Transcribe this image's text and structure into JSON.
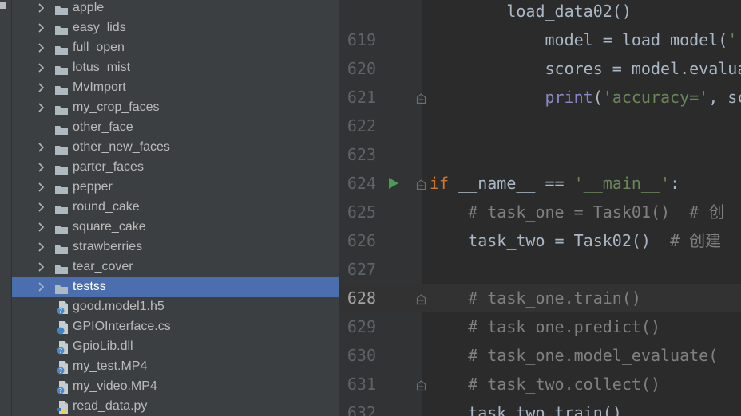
{
  "project_tree": {
    "items": [
      {
        "label": "apple",
        "kind": "folder",
        "expandable": true,
        "selected": false
      },
      {
        "label": "easy_lids",
        "kind": "folder",
        "expandable": true,
        "selected": false
      },
      {
        "label": "full_open",
        "kind": "folder",
        "expandable": true,
        "selected": false
      },
      {
        "label": "lotus_mist",
        "kind": "folder",
        "expandable": true,
        "selected": false
      },
      {
        "label": "MvImport",
        "kind": "folder",
        "expandable": true,
        "selected": false
      },
      {
        "label": "my_crop_faces",
        "kind": "folder",
        "expandable": true,
        "selected": false
      },
      {
        "label": "other_face",
        "kind": "folder",
        "expandable": false,
        "selected": false
      },
      {
        "label": "other_new_faces",
        "kind": "folder",
        "expandable": true,
        "selected": false
      },
      {
        "label": "parter_faces",
        "kind": "folder",
        "expandable": true,
        "selected": false
      },
      {
        "label": "pepper",
        "kind": "folder",
        "expandable": true,
        "selected": false
      },
      {
        "label": "round_cake",
        "kind": "folder",
        "expandable": true,
        "selected": false
      },
      {
        "label": "square_cake",
        "kind": "folder",
        "expandable": true,
        "selected": false
      },
      {
        "label": "strawberries",
        "kind": "folder",
        "expandable": true,
        "selected": false
      },
      {
        "label": "tear_cover",
        "kind": "folder",
        "expandable": true,
        "selected": false
      },
      {
        "label": "testss",
        "kind": "folder",
        "expandable": true,
        "selected": true
      },
      {
        "label": "good.model1.h5",
        "kind": "file",
        "icon": "unknown-file-icon",
        "selected": false
      },
      {
        "label": "GPIOInterface.cs",
        "kind": "file",
        "icon": "csharp-file-icon",
        "selected": false
      },
      {
        "label": "GpioLib.dll",
        "kind": "file",
        "icon": "unknown-file-icon",
        "selected": false
      },
      {
        "label": "my_test.MP4",
        "kind": "file",
        "icon": "unknown-file-icon",
        "selected": false
      },
      {
        "label": "my_video.MP4",
        "kind": "file",
        "icon": "unknown-file-icon",
        "selected": false
      },
      {
        "label": "read_data.py",
        "kind": "file",
        "icon": "python-file-icon",
        "selected": false
      }
    ]
  },
  "editor": {
    "current_line": "628",
    "lines": [
      {
        "number": "",
        "run": false,
        "fold": false,
        "tokens": [
          {
            "t": "        load_data02()",
            "c": "plain"
          }
        ]
      },
      {
        "number": "619",
        "run": false,
        "fold": false,
        "tokens": [
          {
            "t": "            model = load_model(",
            "c": "plain"
          },
          {
            "t": "'./",
            "c": "str"
          }
        ]
      },
      {
        "number": "620",
        "run": false,
        "fold": false,
        "tokens": [
          {
            "t": "            scores = model.evaluat",
            "c": "plain"
          }
        ]
      },
      {
        "number": "621",
        "run": false,
        "fold": true,
        "tokens": [
          {
            "t": "            ",
            "c": "plain"
          },
          {
            "t": "print",
            "c": "bi"
          },
          {
            "t": "(",
            "c": "plain"
          },
          {
            "t": "'accuracy='",
            "c": "str"
          },
          {
            "t": ", sco",
            "c": "plain"
          }
        ]
      },
      {
        "number": "622",
        "run": false,
        "fold": false,
        "tokens": []
      },
      {
        "number": "623",
        "run": false,
        "fold": false,
        "tokens": []
      },
      {
        "number": "624",
        "run": true,
        "fold": true,
        "tokens": [
          {
            "t": "if",
            "c": "kw"
          },
          {
            "t": " __name__ == ",
            "c": "plain"
          },
          {
            "t": "'__main__'",
            "c": "str"
          },
          {
            "t": ":",
            "c": "plain"
          }
        ]
      },
      {
        "number": "625",
        "run": false,
        "fold": false,
        "tokens": [
          {
            "t": "    ",
            "c": "plain"
          },
          {
            "t": "# task_one = Task01()  # 创",
            "c": "cm"
          }
        ]
      },
      {
        "number": "626",
        "run": false,
        "fold": false,
        "tokens": [
          {
            "t": "    task_two = Task02()  ",
            "c": "plain"
          },
          {
            "t": "# 创建",
            "c": "cm"
          }
        ]
      },
      {
        "number": "627",
        "run": false,
        "fold": false,
        "tokens": []
      },
      {
        "number": "628",
        "run": false,
        "fold": true,
        "tokens": [
          {
            "t": "    ",
            "c": "plain"
          },
          {
            "t": "# task_one.train()",
            "c": "cm"
          }
        ]
      },
      {
        "number": "629",
        "run": false,
        "fold": false,
        "tokens": [
          {
            "t": "    ",
            "c": "plain"
          },
          {
            "t": "# task_one.predict()",
            "c": "cm"
          }
        ]
      },
      {
        "number": "630",
        "run": false,
        "fold": false,
        "tokens": [
          {
            "t": "    ",
            "c": "plain"
          },
          {
            "t": "# task_one.model_evaluate(",
            "c": "cm"
          }
        ]
      },
      {
        "number": "631",
        "run": false,
        "fold": true,
        "tokens": [
          {
            "t": "    ",
            "c": "plain"
          },
          {
            "t": "# task_two.collect()",
            "c": "cm"
          }
        ]
      },
      {
        "number": "632",
        "run": false,
        "fold": false,
        "tokens": [
          {
            "t": "    task_two.train()",
            "c": "plain"
          }
        ]
      }
    ]
  },
  "colors": {
    "panel_bg": "#3c3f41",
    "editor_bg": "#2b2b2b",
    "gutter_bg": "#313335",
    "selection": "#4b6eaf",
    "keyword": "#cc7832",
    "string": "#6a8759",
    "comment": "#808080",
    "builtin": "#8888c6",
    "run_icon": "#499c54"
  }
}
